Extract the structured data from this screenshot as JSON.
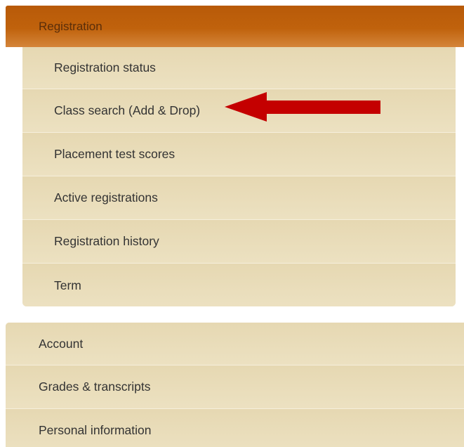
{
  "registration_menu": {
    "header_label": "Registration",
    "items": [
      {
        "label": "Registration status"
      },
      {
        "label": "Class search (Add & Drop)"
      },
      {
        "label": "Placement test scores"
      },
      {
        "label": "Active registrations"
      },
      {
        "label": "Registration history"
      },
      {
        "label": "Term"
      }
    ]
  },
  "main_menu": {
    "items": [
      {
        "label": "Account"
      },
      {
        "label": "Grades & transcripts"
      },
      {
        "label": "Personal information"
      }
    ]
  },
  "annotation": {
    "arrow_icon": "left-arrow-icon",
    "arrow_color": "#c40000"
  },
  "colors": {
    "header_accent": "#c0620c",
    "menu_background": "#e9dcb8"
  }
}
